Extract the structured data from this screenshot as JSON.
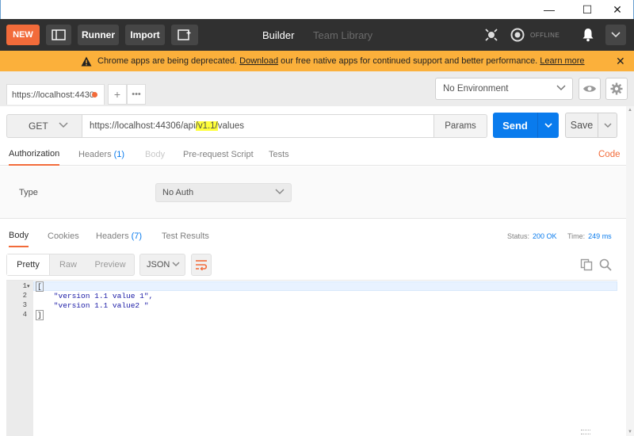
{
  "window": {
    "minimize": "—",
    "maximize": "☐",
    "close": "✕"
  },
  "header": {
    "new_label": "NEW",
    "runner_label": "Runner",
    "import_label": "Import",
    "builder_tab": "Builder",
    "team_library_tab": "Team Library",
    "offline_label": "OFFLINE"
  },
  "banner": {
    "msg_pre": "Chrome apps are being deprecated. ",
    "download_link": "Download",
    "msg_mid": " our free native apps for continued support and better performance. ",
    "learn_more_link": "Learn more"
  },
  "tabs": {
    "request_tab_label": "https://localhost:4430",
    "add": "+",
    "more": "•••"
  },
  "environment": {
    "selected": "No Environment"
  },
  "request": {
    "method": "GET",
    "url_pre": "https://localhost:44306/api",
    "url_highlight": "/v1.1/",
    "url_post": "values",
    "params_label": "Params",
    "send_label": "Send",
    "save_label": "Save"
  },
  "request_tabs": [
    {
      "label": "Authorization"
    },
    {
      "label": "Headers",
      "count": "(1)"
    },
    {
      "label": "Body"
    },
    {
      "label": "Pre-request Script"
    },
    {
      "label": "Tests"
    }
  ],
  "code_link": "Code",
  "auth": {
    "type_label": "Type",
    "type_value": "No Auth"
  },
  "response_tabs": [
    {
      "label": "Body"
    },
    {
      "label": "Cookies"
    },
    {
      "label": "Headers",
      "count": "(7)"
    },
    {
      "label": "Test Results"
    }
  ],
  "response_status": {
    "status_label": "Status:",
    "status_value": "200 OK",
    "time_label": "Time:",
    "time_value": "249 ms"
  },
  "view_modes": [
    "Pretty",
    "Raw",
    "Preview"
  ],
  "format": "JSON",
  "response_body": {
    "line_numbers": [
      "1",
      "2",
      "3",
      "4"
    ],
    "lines": [
      "[",
      "    \"version 1.1 value 1\",",
      "    \"version 1.1 value2 \"",
      "]"
    ]
  },
  "colors": {
    "accent": "#f26b3a",
    "send": "#097bed",
    "banner": "#fbb03b",
    "header": "#303030",
    "highlight": "#ffff3a"
  },
  "icons": [
    "sidebar-toggle-icon",
    "new-window-icon",
    "interceptor-icon",
    "sync-icon",
    "bell-icon",
    "chevron-down-icon",
    "eye-icon",
    "gear-icon",
    "warning-icon",
    "wrap-icon",
    "copy-icon",
    "search-icon"
  ]
}
